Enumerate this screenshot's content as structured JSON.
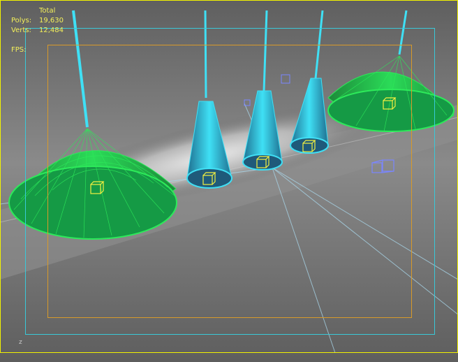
{
  "viewport": {
    "stats": {
      "header": "Total",
      "polys_label": "Polys:",
      "polys_value": "19,630",
      "verts_label": "Verts:",
      "verts_value": "12,484",
      "fps_label": "FPS:"
    },
    "axis_label": "z"
  },
  "colors": {
    "background": "#6b6b6b",
    "safe_frame_outer": "#f2f200",
    "safe_frame_action": "#39c9d9",
    "safe_frame_title": "#d89a2a",
    "wire_green": "#2dea5a",
    "wire_cyan": "#3fe0f5",
    "light_line": "#a9d8ec",
    "gizmo": "#f4f040",
    "camera_icon": "#7a86ff"
  },
  "icons": [
    "camera-icon",
    "light-gizmo-icon",
    "light-target-icon"
  ]
}
